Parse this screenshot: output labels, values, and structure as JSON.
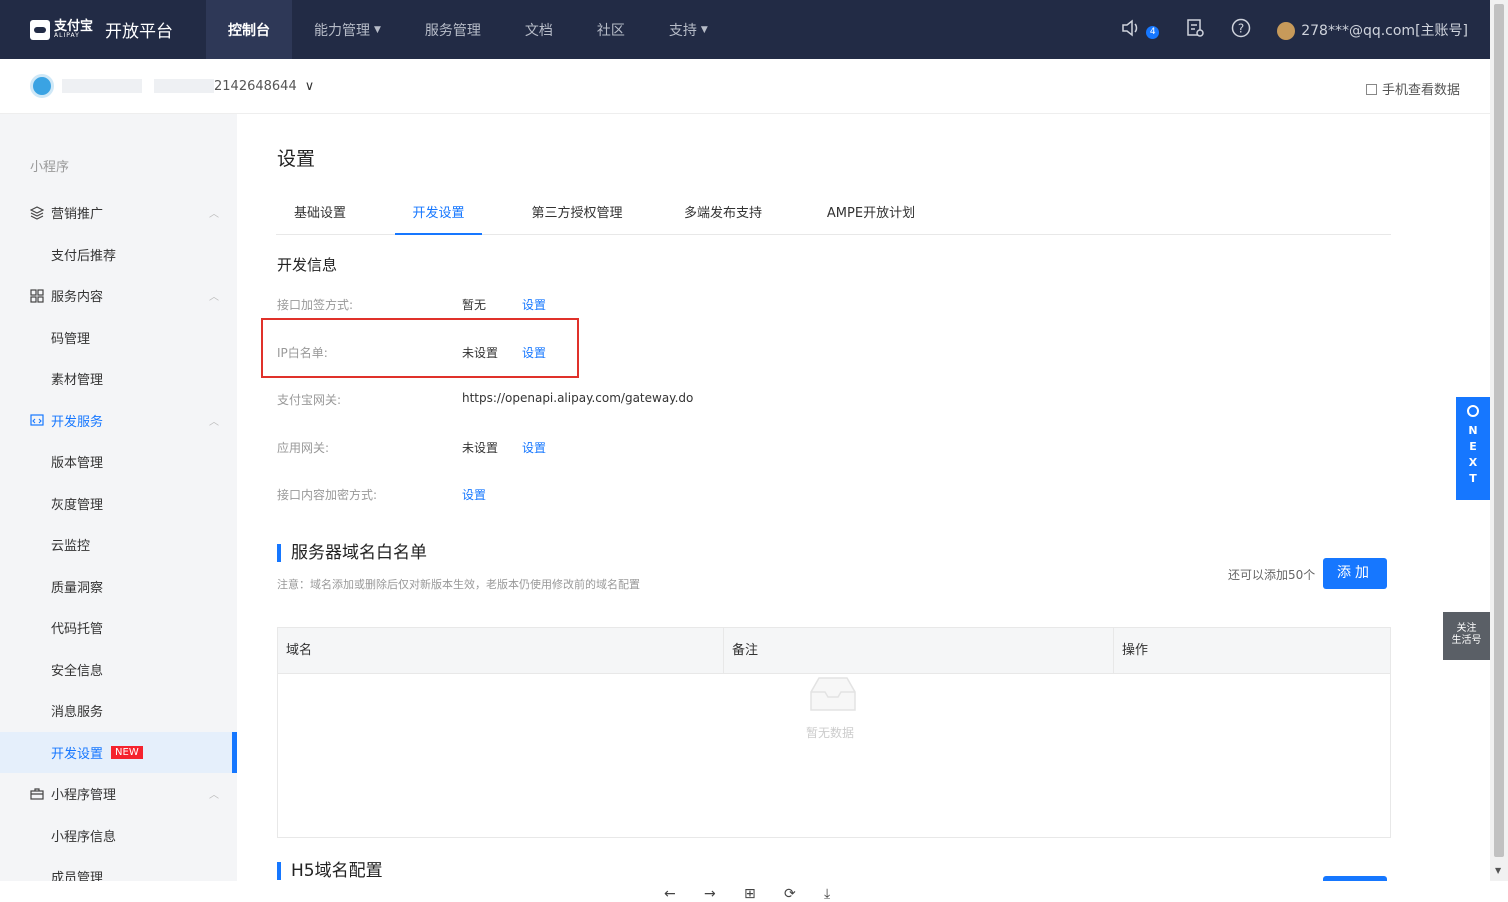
{
  "topnav": {
    "brand_cn": "支付宝",
    "brand_en": "ALIPAY",
    "platform": "开放平台",
    "items": [
      "控制台",
      "能力管理",
      "服务管理",
      "文档",
      "社区",
      "支持"
    ],
    "notification_count": "4",
    "account": "278***@qq.com[主账号]"
  },
  "subheader": {
    "app_id": "2142648644",
    "mobile_data": "手机查看数据"
  },
  "sidebar": {
    "section_title": "小程序",
    "groups": [
      {
        "label": "营销推广",
        "items": [
          "支付后推荐"
        ]
      },
      {
        "label": "服务内容",
        "items": [
          "码管理",
          "素材管理"
        ]
      },
      {
        "label": "开发服务",
        "items": [
          "版本管理",
          "灰度管理",
          "云监控",
          "质量洞察",
          "代码托管",
          "安全信息",
          "消息服务",
          "开发设置"
        ]
      },
      {
        "label": "小程序管理",
        "items": [
          "小程序信息",
          "成员管理"
        ]
      }
    ],
    "new_tag": "NEW"
  },
  "content": {
    "title": "设置",
    "tabs": [
      "基础设置",
      "开发设置",
      "第三方授权管理",
      "多端发布支持",
      "AMPE开放计划"
    ],
    "dev_info_title": "开发信息",
    "rows": [
      {
        "label": "接口加签方式:",
        "value": "暂无",
        "link": "设置"
      },
      {
        "label": "IP白名单:",
        "value": "未设置",
        "link": "设置"
      },
      {
        "label": "支付宝网关:",
        "value": "https://openapi.alipay.com/gateway.do",
        "link": ""
      },
      {
        "label": "应用网关:",
        "value": "未设置",
        "link": "设置"
      },
      {
        "label": "接口内容加密方式:",
        "value": "",
        "link": "设置"
      }
    ],
    "domain_section": {
      "title": "服务器域名白名单",
      "note": "注意：域名添加或删除后仅对新版本生效，老版本仍使用修改前的域名配置",
      "remaining": "还可以添加50个",
      "add_button": "添加",
      "columns": [
        "域名",
        "备注",
        "操作"
      ],
      "empty_text": "暂无数据"
    },
    "h5_section_title": "H5域名配置"
  },
  "widgets": {
    "next_letters": [
      "N",
      "E",
      "X",
      "T"
    ],
    "follow_line1": "关注",
    "follow_line2": "生活号"
  },
  "bottom_bar": [
    "←",
    "→",
    "⊞",
    "⟳",
    "⤓"
  ],
  "colors": {
    "nav_bg": "#222b45",
    "accent": "#1677ff",
    "highlight_box": "#e0312a"
  }
}
